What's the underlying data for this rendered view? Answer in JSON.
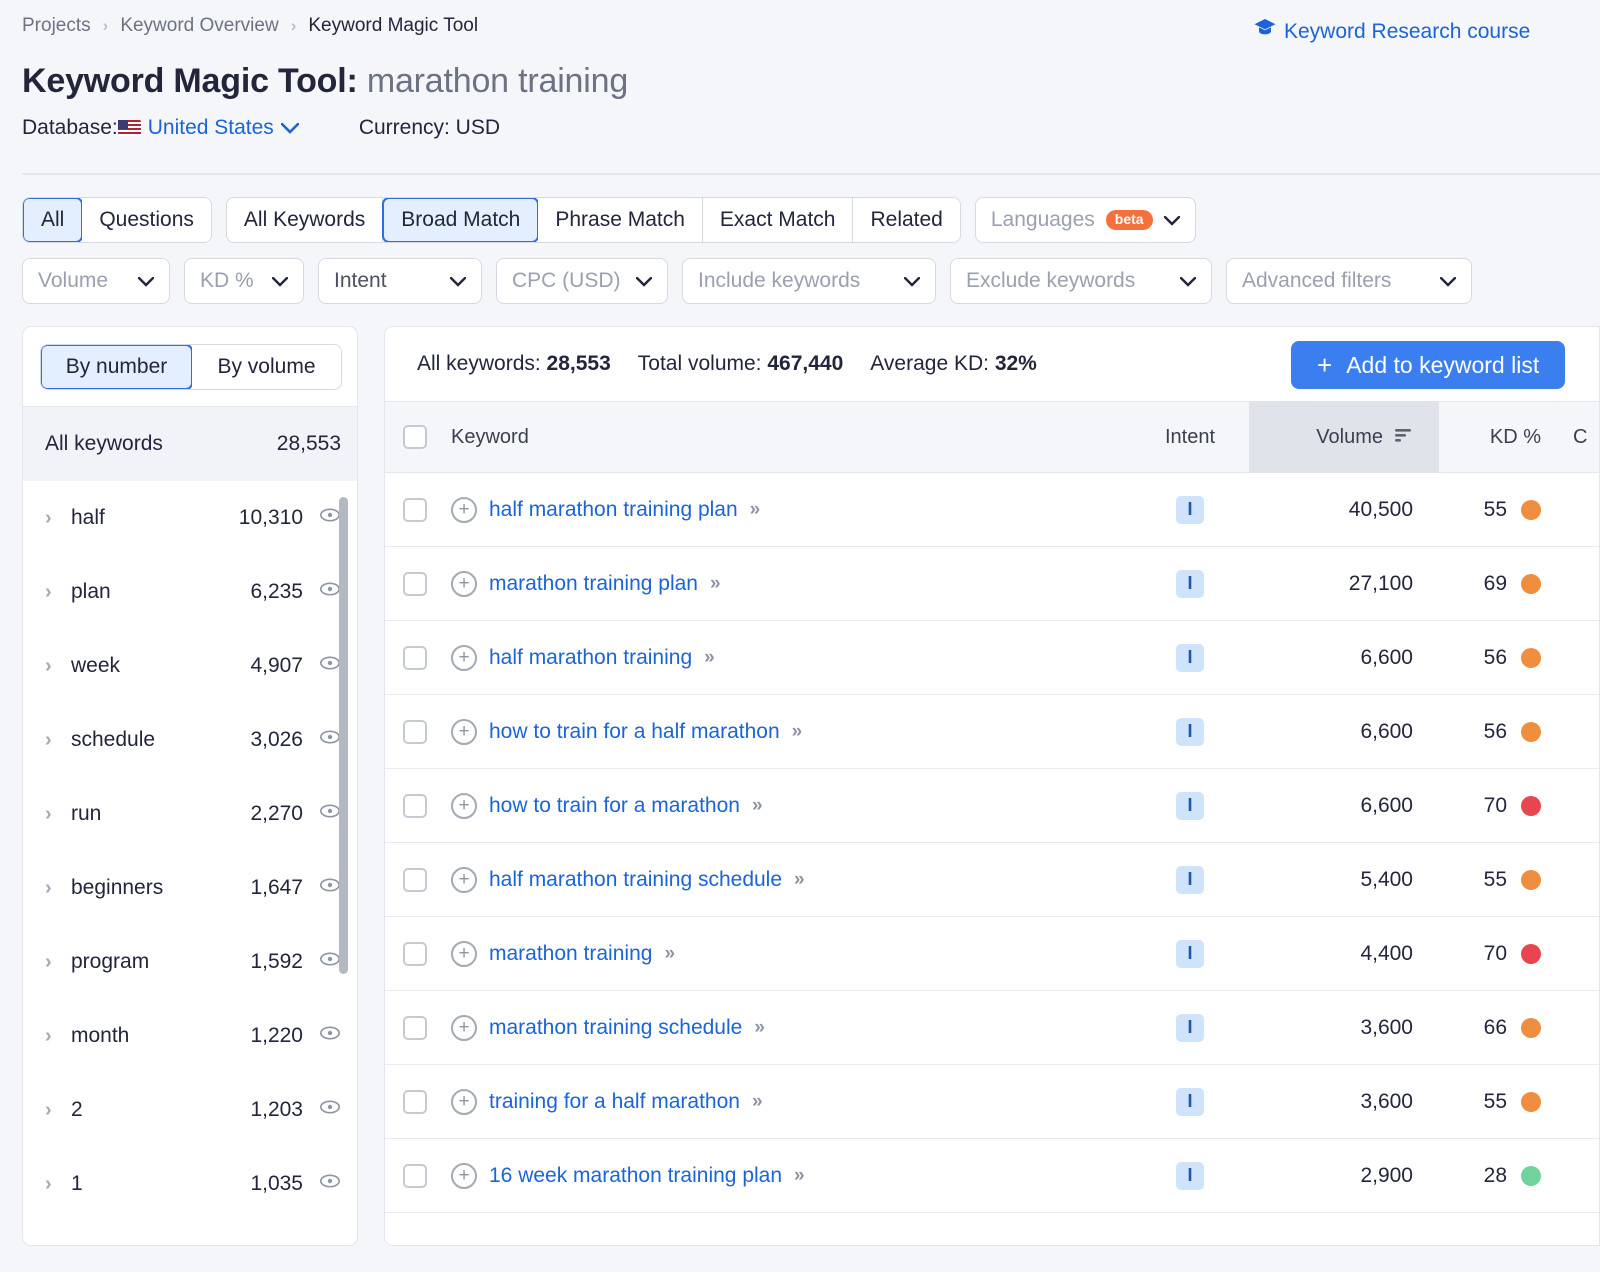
{
  "breadcrumb": {
    "items": [
      "Projects",
      "Keyword Overview",
      "Keyword Magic Tool"
    ],
    "separator": "›"
  },
  "course_link": {
    "label": "Keyword Research course",
    "icon": "graduation-cap-icon"
  },
  "title": {
    "prefix": "Keyword Magic Tool:",
    "query": "marathon training"
  },
  "meta": {
    "database_label": "Database:",
    "database_value": "United States",
    "currency_label": "Currency: USD",
    "caret": "⌄"
  },
  "filters": {
    "type_tabs": [
      {
        "label": "All",
        "active": true
      },
      {
        "label": "Questions",
        "active": false
      }
    ],
    "match_tabs": [
      {
        "label": "All Keywords",
        "active": false
      },
      {
        "label": "Broad Match",
        "active": true
      },
      {
        "label": "Phrase Match",
        "active": false
      },
      {
        "label": "Exact Match",
        "active": false
      },
      {
        "label": "Related",
        "active": false
      }
    ],
    "languages": {
      "label": "Languages",
      "badge": "beta"
    },
    "dropdowns": [
      {
        "label": "Volume",
        "dark": false
      },
      {
        "label": "KD %",
        "dark": false
      },
      {
        "label": "Intent",
        "dark": true
      },
      {
        "label": "CPC (USD)",
        "dark": false
      },
      {
        "label": "Include keywords",
        "dark": false
      },
      {
        "label": "Exclude keywords",
        "dark": false
      },
      {
        "label": "Advanced filters",
        "dark": false
      }
    ]
  },
  "sidebar": {
    "toggle": [
      {
        "label": "By number",
        "active": true
      },
      {
        "label": "By volume",
        "active": false
      }
    ],
    "all_row": {
      "label": "All keywords",
      "count": "28,553"
    },
    "groups": [
      {
        "label": "half",
        "count": "10,310"
      },
      {
        "label": "plan",
        "count": "6,235"
      },
      {
        "label": "week",
        "count": "4,907"
      },
      {
        "label": "schedule",
        "count": "3,026"
      },
      {
        "label": "run",
        "count": "2,270"
      },
      {
        "label": "beginners",
        "count": "1,647"
      },
      {
        "label": "program",
        "count": "1,592"
      },
      {
        "label": "month",
        "count": "1,220"
      },
      {
        "label": "2",
        "count": "1,203"
      },
      {
        "label": "1",
        "count": "1,035"
      }
    ]
  },
  "panel": {
    "stats": [
      {
        "label": "All keywords:",
        "value": "28,553"
      },
      {
        "label": "Total volume:",
        "value": "467,440"
      },
      {
        "label": "Average KD:",
        "value": "32%"
      }
    ],
    "add_button": {
      "label": "Add to keyword list",
      "plus": "+"
    },
    "columns": {
      "keyword": "Keyword",
      "intent": "Intent",
      "volume": "Volume",
      "kd": "KD %",
      "cpc": "C"
    },
    "rows": [
      {
        "keyword": "half marathon training plan",
        "intent": "I",
        "volume": "40,500",
        "kd": "55",
        "kd_color": "#ef8e3f"
      },
      {
        "keyword": "marathon training plan",
        "intent": "I",
        "volume": "27,100",
        "kd": "69",
        "kd_color": "#ef8e3f"
      },
      {
        "keyword": "half marathon training",
        "intent": "I",
        "volume": "6,600",
        "kd": "56",
        "kd_color": "#ef8e3f"
      },
      {
        "keyword": "how to train for a half marathon",
        "intent": "I",
        "volume": "6,600",
        "kd": "56",
        "kd_color": "#ef8e3f"
      },
      {
        "keyword": "how to train for a marathon",
        "intent": "I",
        "volume": "6,600",
        "kd": "70",
        "kd_color": "#e8454f"
      },
      {
        "keyword": "half marathon training schedule",
        "intent": "I",
        "volume": "5,400",
        "kd": "55",
        "kd_color": "#ef8e3f"
      },
      {
        "keyword": "marathon training",
        "intent": "I",
        "volume": "4,400",
        "kd": "70",
        "kd_color": "#e8454f"
      },
      {
        "keyword": "marathon training schedule",
        "intent": "I",
        "volume": "3,600",
        "kd": "66",
        "kd_color": "#ef8e3f"
      },
      {
        "keyword": "training for a half marathon",
        "intent": "I",
        "volume": "3,600",
        "kd": "55",
        "kd_color": "#ef8e3f"
      },
      {
        "keyword": "16 week marathon training plan",
        "intent": "I",
        "volume": "2,900",
        "kd": "28",
        "kd_color": "#6fd39b"
      }
    ],
    "row_chevrons": "»"
  },
  "colors": {
    "accent_blue": "#1a64d8",
    "button_blue": "#3a7ef0",
    "beta_orange": "#f4713c"
  }
}
